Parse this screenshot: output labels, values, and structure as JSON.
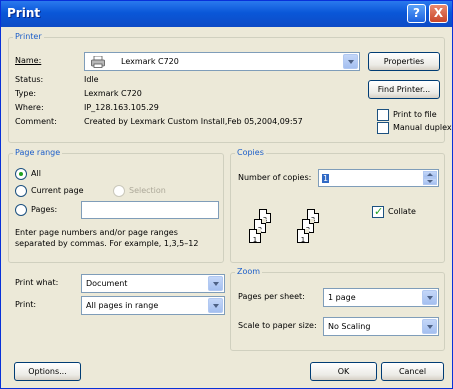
{
  "window": {
    "title": "Print",
    "help_label": "?",
    "close_label": "X"
  },
  "printer": {
    "group_label": "Printer",
    "name_label": "Name:",
    "name_value": "Lexmark C720",
    "status_label": "Status:",
    "status_value": "Idle",
    "type_label": "Type:",
    "type_value": "Lexmark C720",
    "where_label": "Where:",
    "where_value": "IP_128.163.105.29",
    "comment_label": "Comment:",
    "comment_value": "Created by Lexmark Custom Install,Feb 05,2004,09:57",
    "properties_label": "Properties",
    "find_printer_label": "Find Printer...",
    "print_to_file_label": "Print to file",
    "print_to_file_checked": false,
    "manual_duplex_label": "Manual duplex",
    "manual_duplex_checked": false
  },
  "page_range": {
    "group_label": "Page range",
    "all_label": "All",
    "current_page_label": "Current page",
    "selection_label": "Selection",
    "pages_label": "Pages:",
    "pages_value": "",
    "selected": "all",
    "help_text_1": "Enter page numbers and/or page ranges",
    "help_text_2": "separated by commas.  For example, 1,3,5–12"
  },
  "copies": {
    "group_label": "Copies",
    "number_label": "Number of copies:",
    "number_value": "1",
    "collate_label": "Collate",
    "collate_checked": true,
    "pages": [
      "1",
      "2",
      "3"
    ]
  },
  "print_what": {
    "label": "Print what:",
    "value": "Document"
  },
  "print": {
    "label": "Print:",
    "value": "All pages in range"
  },
  "zoom": {
    "group_label": "Zoom",
    "pages_per_sheet_label": "Pages per sheet:",
    "pages_per_sheet_value": "1 page",
    "scale_label": "Scale to paper size:",
    "scale_value": "No Scaling"
  },
  "footer": {
    "options_label": "Options...",
    "ok_label": "OK",
    "cancel_label": "Cancel"
  }
}
